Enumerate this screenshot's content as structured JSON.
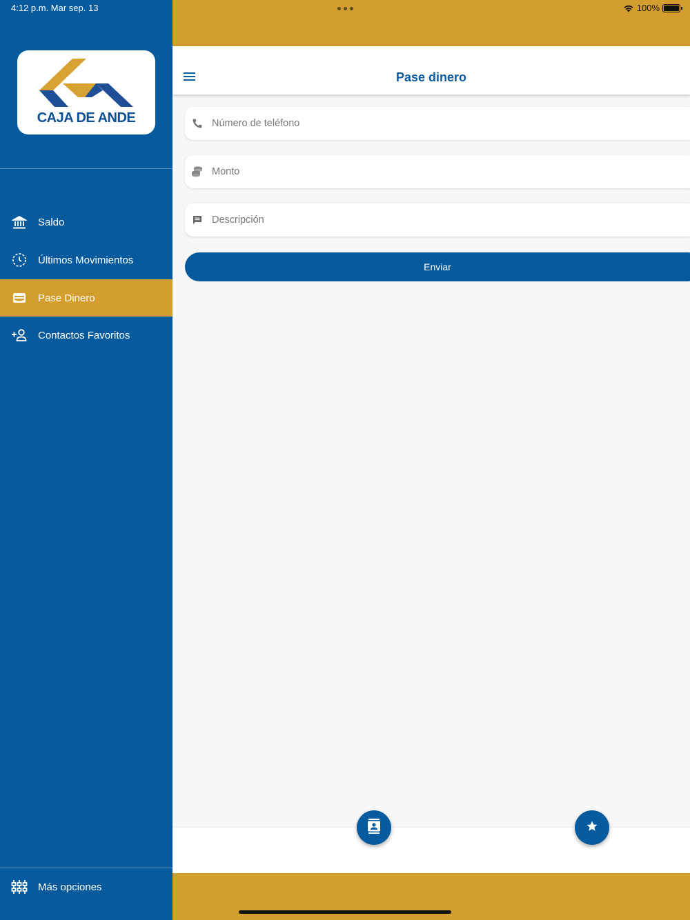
{
  "status_bar": {
    "time_date": "4:12 p.m.   Mar sep. 13",
    "battery": "100%"
  },
  "brand": {
    "logo_text": "CAJA DE ANDE",
    "colors": {
      "primary": "#065A9E",
      "accent": "#D39E2E"
    }
  },
  "sidebar": {
    "items": [
      {
        "label": "Saldo",
        "icon": "bank-icon",
        "active": false
      },
      {
        "label": "Últimos Movimientos",
        "icon": "history-icon",
        "active": false
      },
      {
        "label": "Pase Dinero",
        "icon": "wallet-icon",
        "active": true
      },
      {
        "label": "Contactos Favoritos",
        "icon": "add-person-icon",
        "active": false
      }
    ],
    "footer_item": {
      "label": "Más opciones",
      "icon": "sliders-icon"
    }
  },
  "header": {
    "title": "Pase dinero"
  },
  "form": {
    "phone_placeholder": "Número de teléfono",
    "amount_placeholder": "Monto",
    "description_placeholder": "Descripción",
    "submit_label": "Enviar"
  },
  "bottom_actions": [
    {
      "icon": "contacts-icon"
    },
    {
      "icon": "star-icon"
    }
  ]
}
